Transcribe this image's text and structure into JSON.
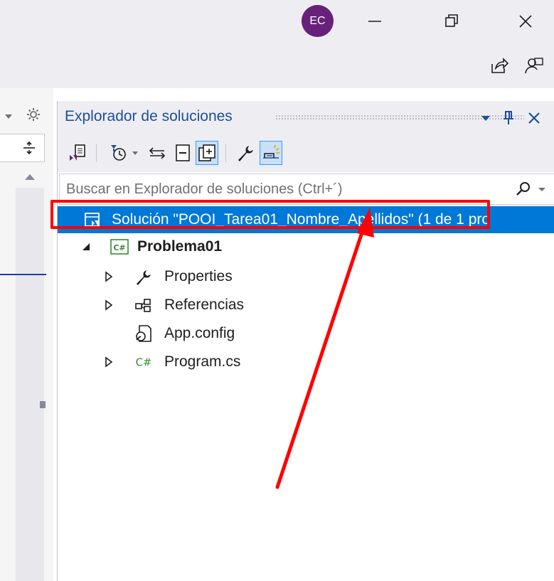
{
  "window": {
    "avatar_initials": "EC",
    "minimize_icon": "minimize-icon",
    "restore_icon": "restore-icon",
    "close_icon": "close-icon",
    "share_icon": "live-share-icon",
    "feedback_icon": "feedback-icon"
  },
  "left_panel": {
    "dropdown_icon": "dropdown-caret-icon",
    "settings_icon": "gear-icon",
    "split_icon": "split-icon",
    "scroll_up_icon": "scroll-up-icon"
  },
  "solution_explorer": {
    "title": "Explorador de soluciones",
    "header_icons": [
      "dropdown-icon",
      "pin-icon",
      "close-icon"
    ],
    "toolbar_icons": [
      "switch-views-icon",
      "pending-changes-filter-icon",
      "dropdown-caret-icon",
      "sync-with-active-document-icon",
      "collapse-all-icon",
      "show-all-files-icon",
      "properties-wrench-icon",
      "preview-selected-items-icon"
    ],
    "search": {
      "placeholder": "Buscar en Explorador de soluciones (Ctrl+´)",
      "icon": "search-icon"
    },
    "tree": [
      {
        "label": "Solución \"POOI_Tarea01_Nombre_Apellidos\"  (1 de 1 pro",
        "icon": "solution-icon",
        "selected": true
      },
      {
        "label": "Problema01",
        "icon": "csharp-project-icon",
        "expanded": true
      },
      {
        "label": "Properties",
        "icon": "wrench-icon",
        "collapsed": true
      },
      {
        "label": "Referencias",
        "icon": "references-icon",
        "collapsed": true
      },
      {
        "label": "App.config",
        "icon": "config-file-icon"
      },
      {
        "label": "Program.cs",
        "icon": "csharp-file-icon",
        "collapsed": true
      }
    ]
  },
  "annotation": {
    "highlight_color": "#ff0000",
    "arrow_color": "#ff0000"
  },
  "colors": {
    "selection": "#0078d7",
    "title_text": "#1e4e9c",
    "chrome": "#eeeef2"
  }
}
